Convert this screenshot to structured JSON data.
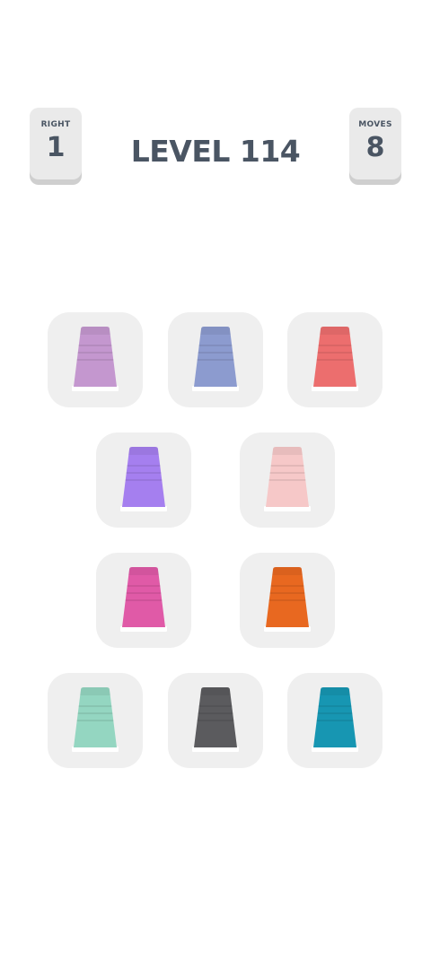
{
  "header": {
    "right_label": "RIGHT",
    "right_value": "1",
    "level_title": "LEVEL 114",
    "moves_label": "MOVES",
    "moves_value": "8"
  },
  "cups": [
    {
      "name": "lilac-cup",
      "color": "#c497cf",
      "icon": "cup-icon"
    },
    {
      "name": "periwinkle-cup",
      "color": "#8c9bcf",
      "icon": "cup-icon"
    },
    {
      "name": "coral-red-cup",
      "color": "#ec6e6e",
      "icon": "cup-icon"
    },
    {
      "name": "violet-cup",
      "color": "#a57fef",
      "icon": "cup-icon"
    },
    {
      "name": "pale-pink-cup",
      "color": "#f6c8c8",
      "icon": "cup-icon"
    },
    {
      "name": "magenta-cup",
      "color": "#e05aa7",
      "icon": "cup-icon"
    },
    {
      "name": "orange-cup",
      "color": "#e86820",
      "icon": "cup-icon"
    },
    {
      "name": "mint-cup",
      "color": "#94d6c1",
      "icon": "cup-icon"
    },
    {
      "name": "charcoal-cup",
      "color": "#5b5b5e",
      "icon": "cup-icon"
    },
    {
      "name": "teal-cup",
      "color": "#1796b2",
      "icon": "cup-icon"
    }
  ]
}
